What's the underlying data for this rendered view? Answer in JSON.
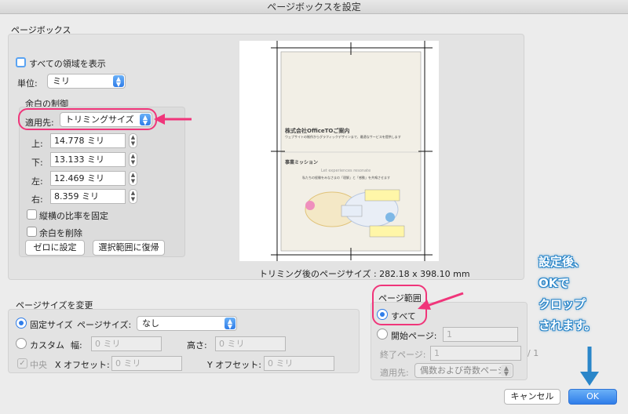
{
  "window": {
    "title": "ページボックスを設定"
  },
  "pagebox": {
    "title": "ページボックス",
    "show_all_label": "すべての領域を表示",
    "unit_label": "単位:",
    "unit_value": "ミリ",
    "margin_control": {
      "title": "余白の制御",
      "apply_to_label": "適用先:",
      "apply_to_value": "トリミングサイズ",
      "top_label": "上:",
      "top_value": "14.778 ミリ",
      "bottom_label": "下:",
      "bottom_value": "13.133 ミリ",
      "left_label": "左:",
      "left_value": "12.469 ミリ",
      "right_label": "右:",
      "right_value": "8.359 ミリ",
      "keep_ratio_label": "縦横の比率を固定",
      "remove_margin_label": "余白を削除",
      "zero_button": "ゼロに設定",
      "restore_button": "選択範囲に復帰"
    }
  },
  "preview": {
    "size_text": "トリミング後のページサイズ : 282.18 x 398.10 mm",
    "slide1_title": "株式会社OfficeTOご案内",
    "slide1_subtitle": "ウェブサイトの制作からグラフィックデザインまで、最適なサービスを提供します",
    "slide2_title": "事業ミッション",
    "slide2_subtitle": "Let experiences resonate",
    "slide2_text": "私たちの経験をみなさまの「理解」と「感動」を共鳴させます"
  },
  "pagesize": {
    "title": "ページサイズを変更",
    "fixed_label": "固定サイズ",
    "page_size_label": "ページサイズ:",
    "page_size_value": "なし",
    "custom_label": "カスタム",
    "width_label": "幅:",
    "width_placeholder": "0 ミリ",
    "height_label": "高さ:",
    "height_placeholder": "0 ミリ",
    "center_label": "中央",
    "x_offset_label": "X オフセット:",
    "x_offset_placeholder": "0 ミリ",
    "y_offset_label": "Y オフセット:",
    "y_offset_placeholder": "0 ミリ"
  },
  "pagerange": {
    "title": "ページ範囲",
    "all_label": "すべて",
    "start_label": "開始ページ:",
    "start_value": "1",
    "end_label": "終了ページ:",
    "end_value": "1",
    "of_total": "/ 1",
    "apply_label": "適用先:",
    "apply_value": "偶数および奇数ページ"
  },
  "footer": {
    "cancel_button": "キャンセル",
    "ok_button": "OK"
  },
  "annotation": {
    "line1": "設定後、",
    "line2": "OKで",
    "line3": "クロップ",
    "line4": "されます。"
  },
  "colors": {
    "accent": "#2f7de9",
    "highlight": "#f0357a",
    "annotation": "#2a86c9"
  }
}
